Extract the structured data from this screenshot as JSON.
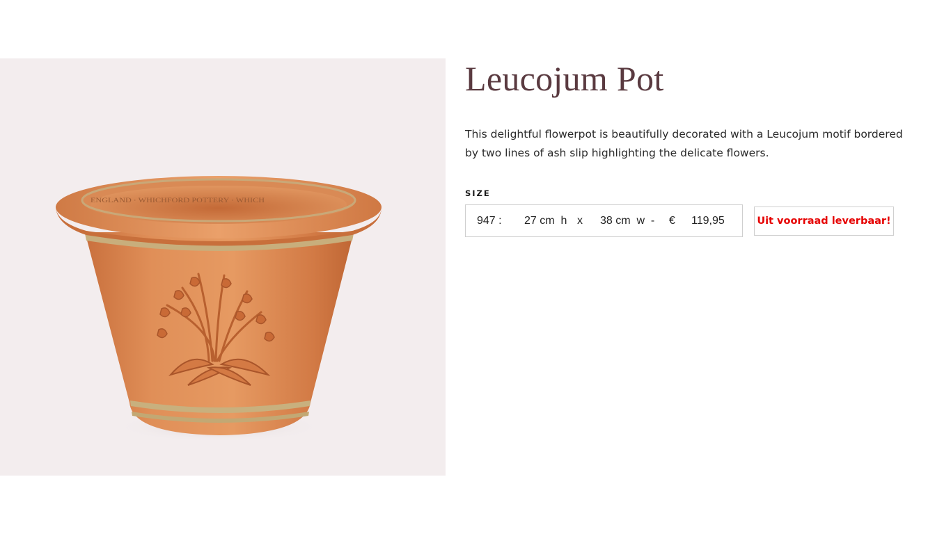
{
  "product": {
    "title": "Leucojum Pot",
    "description": "This delightful flowerpot is beautifully decorated with a Leucojum motif bordered by two lines of ash slip highlighting the delicate flowers.",
    "image_rim_text": "ENGLAND · WHICHFORD POTTERY · WHICH",
    "colors": {
      "title": "#5a3a40",
      "image_background": "#f3edee",
      "terracotta": "#d9834e",
      "stock_badge_text": "#e60000"
    }
  },
  "size": {
    "label": "SIZE",
    "selected": {
      "code": "947 :",
      "height": "27 cm  h",
      "separator": "x",
      "width": "38 cm  w  -",
      "currency": "€",
      "price": "119,95"
    }
  },
  "stock": {
    "status": "Uit voorraad leverbaar!"
  }
}
